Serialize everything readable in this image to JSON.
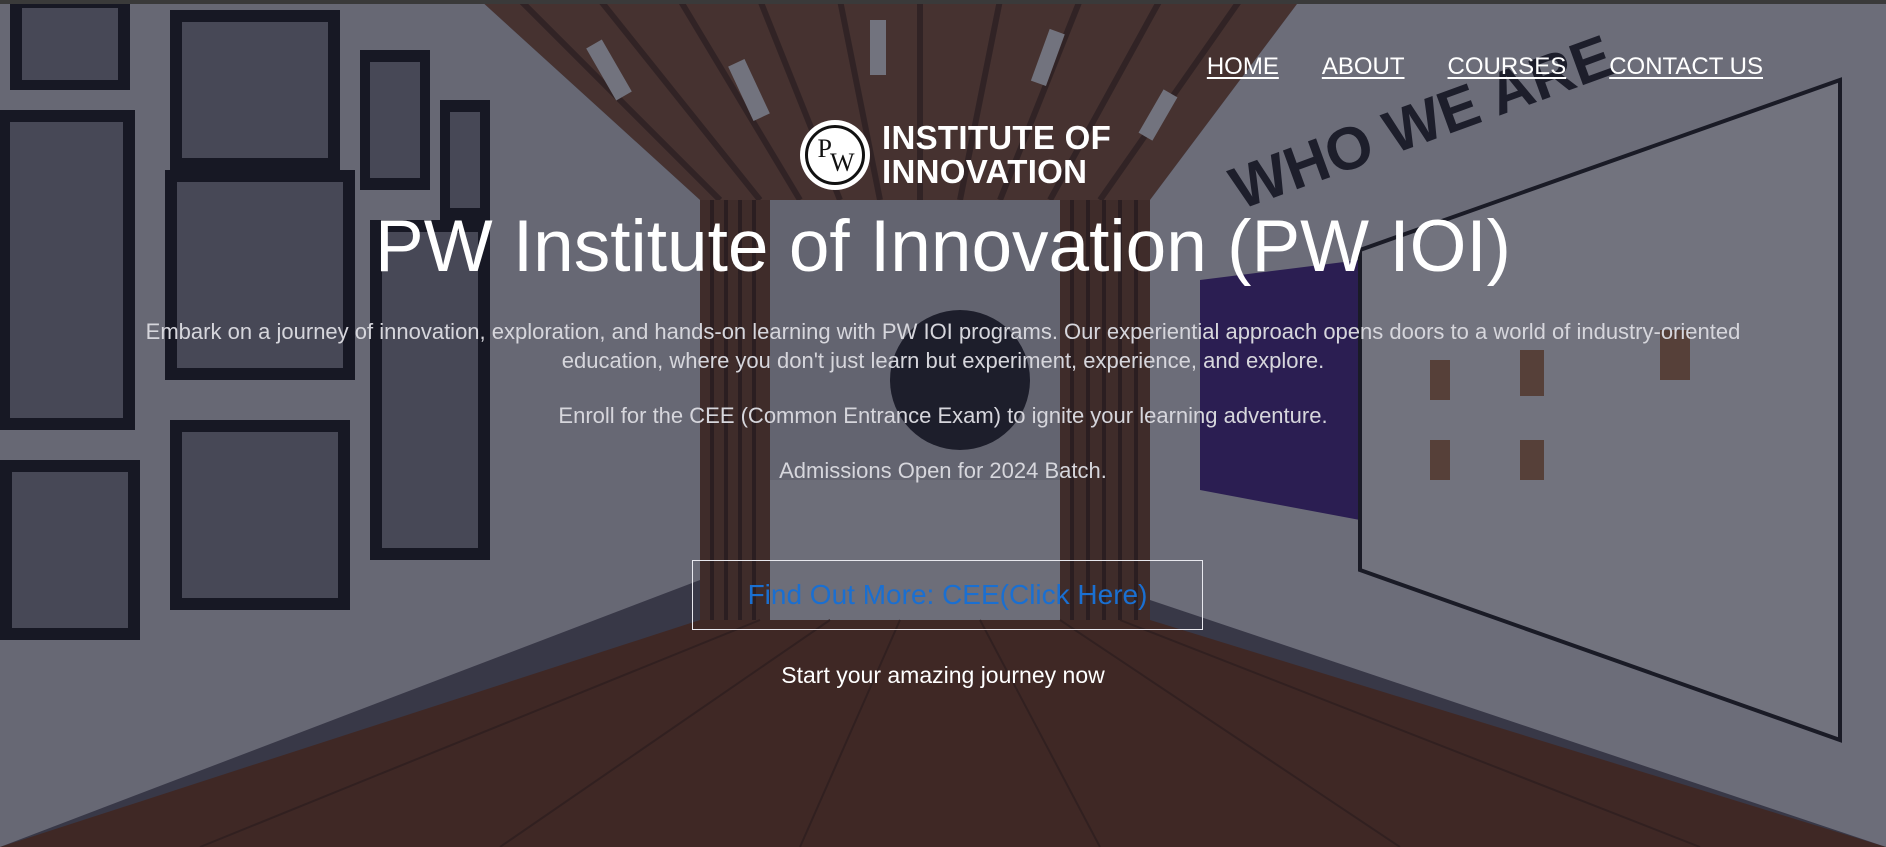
{
  "nav": {
    "items": [
      {
        "label": "HOME"
      },
      {
        "label": "ABOUT"
      },
      {
        "label": "COURSES"
      },
      {
        "label": "CONTACT US"
      }
    ]
  },
  "logo": {
    "mark": "PW",
    "line1": "INSTITUTE OF",
    "line2": "INNOVATION"
  },
  "hero": {
    "title": "PW Institute of Innovation (PW IOI)",
    "intro": "Embark on a journey of innovation, exploration, and hands-on learning with PW IOI programs. Our experiential approach opens doors to a world of industry-oriented education, where you don't just learn but experiment, experience, and explore.",
    "enroll": "Enroll for the CEE (Common Entrance Exam) to ignite your learning adventure.",
    "admissions": "Admissions Open for 2024 Batch.",
    "cta_label": "Find Out More: CEE(Click Here)",
    "tagline": "Start your amazing journey now",
    "background_wall_text": "WHO WE ARE"
  },
  "colors": {
    "cta_text": "#1a6fd1",
    "overlay": "#14162a",
    "text_primary": "#ffffff",
    "text_secondary": "#d6d6dc"
  }
}
